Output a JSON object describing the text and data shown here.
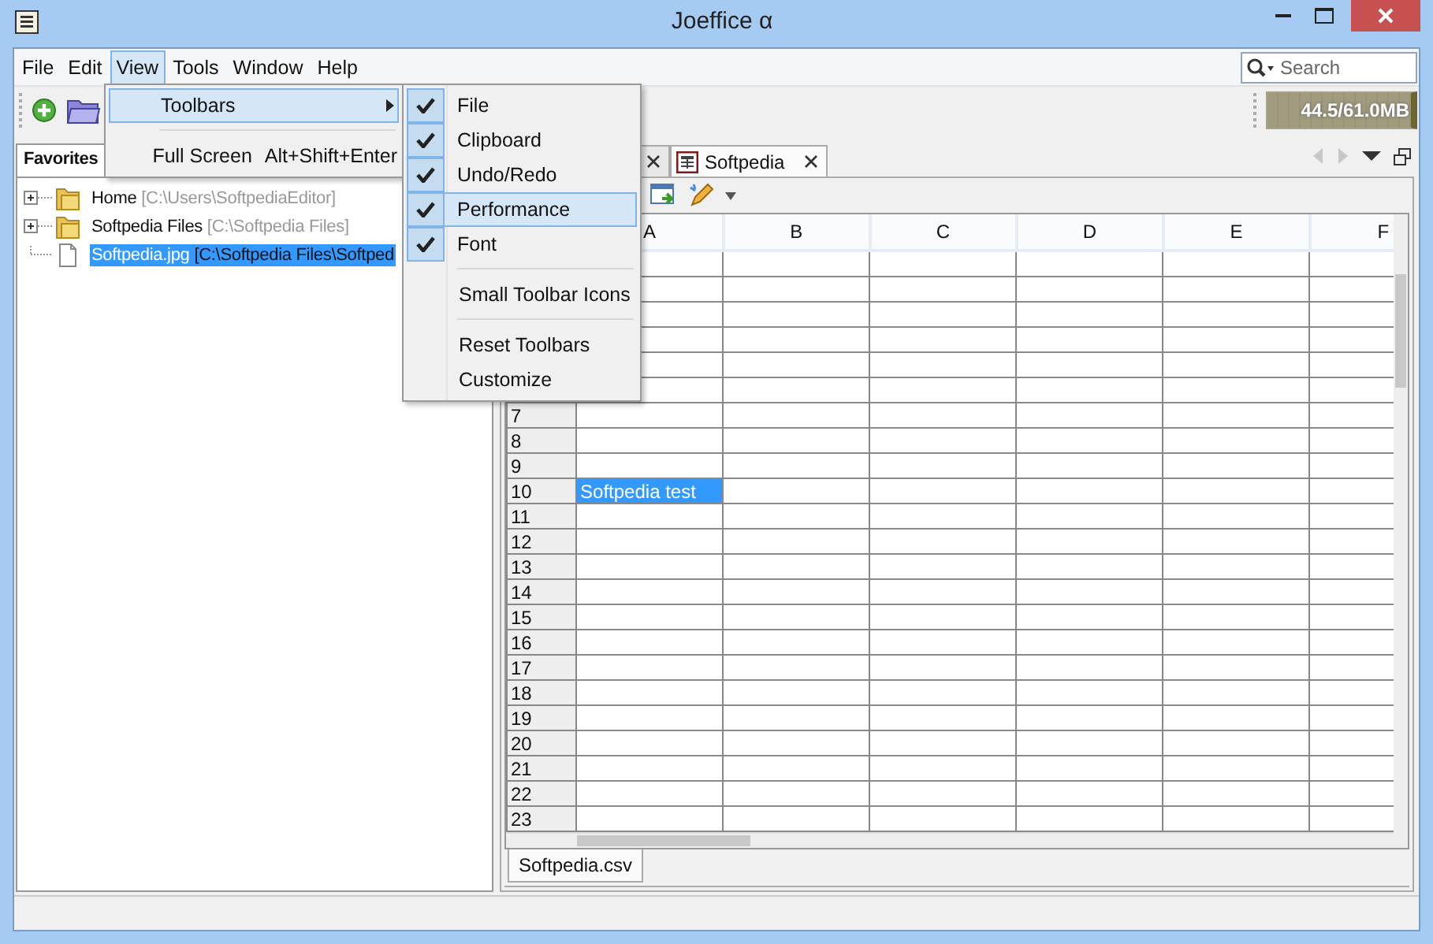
{
  "window": {
    "title": "Joeffice α"
  },
  "menu_bar": [
    {
      "label": "File",
      "selected": false
    },
    {
      "label": "Edit",
      "selected": false
    },
    {
      "label": "View",
      "selected": true
    },
    {
      "label": "Tools",
      "selected": false
    },
    {
      "label": "Window",
      "selected": false
    },
    {
      "label": "Help",
      "selected": false
    }
  ],
  "search": {
    "placeholder": "Search"
  },
  "toolbar": {
    "memory": "44.5/61.0MB"
  },
  "favorites": {
    "tab": "Favorites",
    "items": [
      {
        "kind": "folder",
        "name": "Home",
        "path": "[C:\\Users\\SoftpediaEditor]",
        "selected": false
      },
      {
        "kind": "folder",
        "name": "Softpedia Files",
        "path": "[C:\\Softpedia Files]",
        "selected": false
      },
      {
        "kind": "file",
        "name": "Softpedia.jpg",
        "path": "[C:\\Softpedia Files\\Softped",
        "selected": true
      }
    ]
  },
  "editor": {
    "tabs": [
      {
        "selected": false
      },
      {
        "title": "Softpedia",
        "selected": true
      }
    ],
    "columns": [
      "A",
      "B",
      "C",
      "D",
      "E",
      "F"
    ],
    "rows": [
      {
        "covered": true
      },
      {
        "covered": true
      },
      {
        "covered": true
      },
      {
        "covered": true
      },
      {
        "covered": true
      },
      {
        "covered": true
      },
      {
        "number": "7"
      },
      {
        "number": "8"
      },
      {
        "number": "9"
      },
      {
        "number": "10",
        "cells": [
          {
            "text": "Softpedia test",
            "selected": true
          }
        ]
      },
      {
        "number": "11"
      },
      {
        "number": "12"
      },
      {
        "number": "13"
      },
      {
        "number": "14"
      },
      {
        "number": "15"
      },
      {
        "number": "16"
      },
      {
        "number": "17"
      },
      {
        "number": "18"
      },
      {
        "number": "19"
      },
      {
        "number": "20"
      },
      {
        "number": "21"
      },
      {
        "number": "22"
      },
      {
        "number": "23"
      }
    ],
    "sheet_tabs": [
      {
        "label": "Softpedia.csv",
        "selected": true
      }
    ]
  },
  "view_menu": {
    "items": [
      {
        "kind": "submenu",
        "label": "Toolbars",
        "highlighted": true
      },
      {
        "kind": "separator"
      },
      {
        "kind": "item",
        "label": "Full Screen",
        "shortcut": "Alt+Shift+Enter",
        "highlighted": false
      }
    ]
  },
  "toolbars_submenu": {
    "items": [
      {
        "kind": "check",
        "label": "File",
        "checked": true,
        "highlighted": false
      },
      {
        "kind": "check",
        "label": "Clipboard",
        "checked": true,
        "highlighted": false
      },
      {
        "kind": "check",
        "label": "Undo/Redo",
        "checked": true,
        "highlighted": false
      },
      {
        "kind": "check",
        "label": "Performance",
        "checked": true,
        "highlighted": true
      },
      {
        "kind": "check",
        "label": "Font",
        "checked": true,
        "highlighted": false
      },
      {
        "kind": "separator"
      },
      {
        "kind": "check",
        "label": "Small Toolbar Icons",
        "checked": false,
        "highlighted": false
      },
      {
        "kind": "separator"
      },
      {
        "kind": "item",
        "label": "Reset Toolbars",
        "highlighted": false
      },
      {
        "kind": "item",
        "label": "Customize",
        "highlighted": false
      }
    ]
  }
}
